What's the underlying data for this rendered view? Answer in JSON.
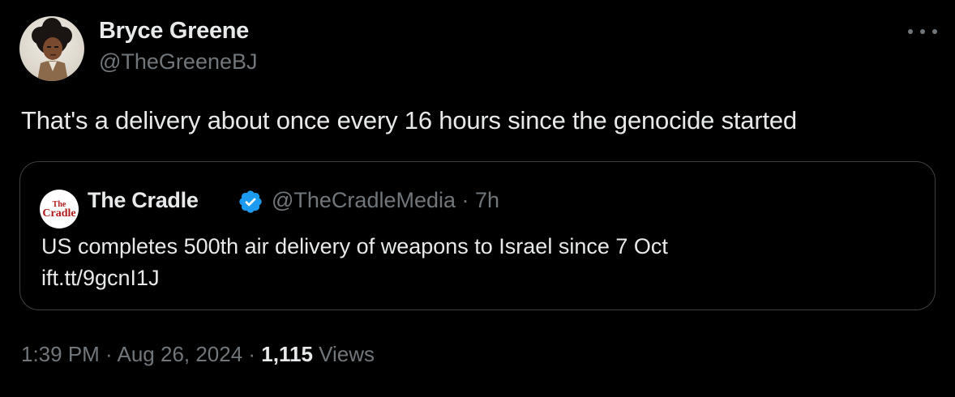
{
  "author": {
    "display_name": "Bryce Greene",
    "handle": "@TheGreeneBJ",
    "avatar_icon": "cartoon-avatar-icon"
  },
  "more_icon": "more-horizontal-icon",
  "tweet": {
    "text": "That's a delivery about once every 16 hours since the genocide started"
  },
  "quoted_tweet": {
    "logo_text_top": "The",
    "logo_text_bottom": "Cradle",
    "name": "The Cradle",
    "verified_icon": "verified-badge-icon",
    "verified_color": "#1d9bf0",
    "handle_time": "@TheCradleMedia · 7h",
    "text_line1": "US completes 500th air delivery of weapons to Israel since 7 Oct",
    "text_line2": "ift.tt/9gcnI1J"
  },
  "meta": {
    "timestamp": "1:39 PM · Aug 26, 2024 · ",
    "views_count": "1,115",
    "views_label": " Views"
  },
  "colors": {
    "background": "#000000",
    "primary_text": "#e7e9ea",
    "secondary_text": "#71767b",
    "border": "#3e4144",
    "logo_red": "#b11a1a"
  }
}
